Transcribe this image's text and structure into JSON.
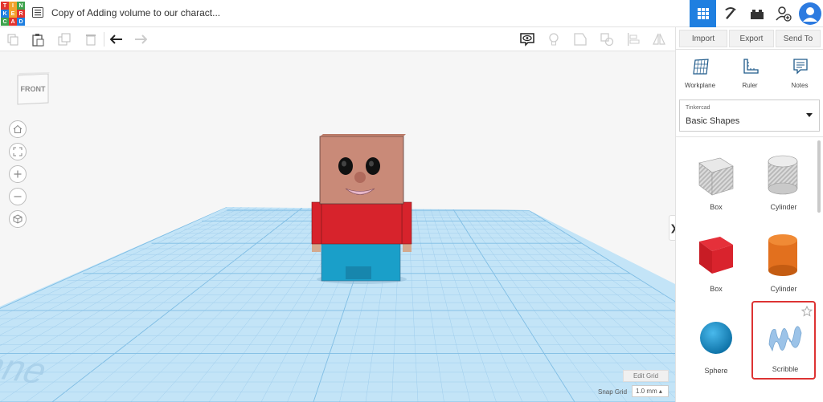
{
  "header": {
    "logo_letters": [
      "T",
      "I",
      "N",
      "K",
      "E",
      "R",
      "C",
      "A",
      "D"
    ],
    "logo_colors": [
      "#e2342f",
      "#f2a22c",
      "#3fa34d",
      "#1f7fe0",
      "#f2a22c",
      "#e2342f",
      "#3fa34d",
      "#e2342f",
      "#1f7fe0"
    ],
    "doc_title": "Copy of Adding volume to our charact..."
  },
  "panel": {
    "import_label": "Import",
    "export_label": "Export",
    "send_label": "Send To",
    "tools": [
      {
        "label": "Workplane"
      },
      {
        "label": "Ruler"
      },
      {
        "label": "Notes"
      }
    ],
    "library_small": "Tinkercad",
    "library_name": "Basic Shapes",
    "shapes": [
      {
        "label": "Box"
      },
      {
        "label": "Cylinder"
      },
      {
        "label": "Box"
      },
      {
        "label": "Cylinder"
      },
      {
        "label": "Sphere"
      },
      {
        "label": "Scribble"
      }
    ]
  },
  "viewport": {
    "view_cube_label": "FRONT",
    "workplane_text": "Workplane",
    "edit_grid_label": "Edit Grid",
    "snap_grid_label": "Snap Grid",
    "snap_grid_value": "1.0 mm ▴"
  },
  "colors": {
    "accent": "#1f7fe0",
    "grid": "#a9d4ef",
    "highlight": "#d33c2f"
  }
}
